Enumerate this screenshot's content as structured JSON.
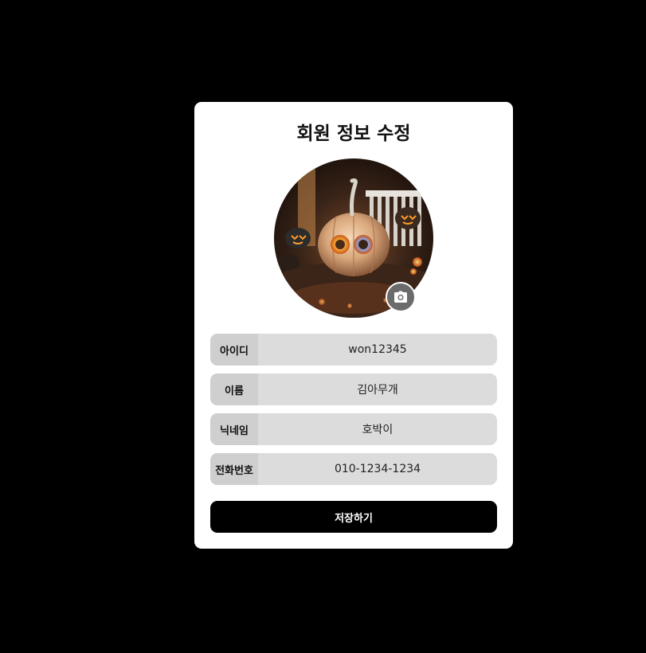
{
  "page": {
    "title": "회원 정보 수정"
  },
  "profile": {
    "avatar_icon": "jack-o-lantern-photo",
    "camera_icon": "camera-icon"
  },
  "fields": [
    {
      "label": "아이디",
      "value": "won12345"
    },
    {
      "label": "이름",
      "value": "김아무개"
    },
    {
      "label": "닉네임",
      "value": "호박이"
    },
    {
      "label": "전화번호",
      "value": "010-1234-1234"
    }
  ],
  "actions": {
    "save_label": "저장하기"
  },
  "colors": {
    "background": "#000000",
    "card": "#ffffff",
    "field_bg": "#dcdcdc",
    "label_bg": "#cfcfcf",
    "button": "#000000",
    "camera_button": "#6b6b6b"
  }
}
